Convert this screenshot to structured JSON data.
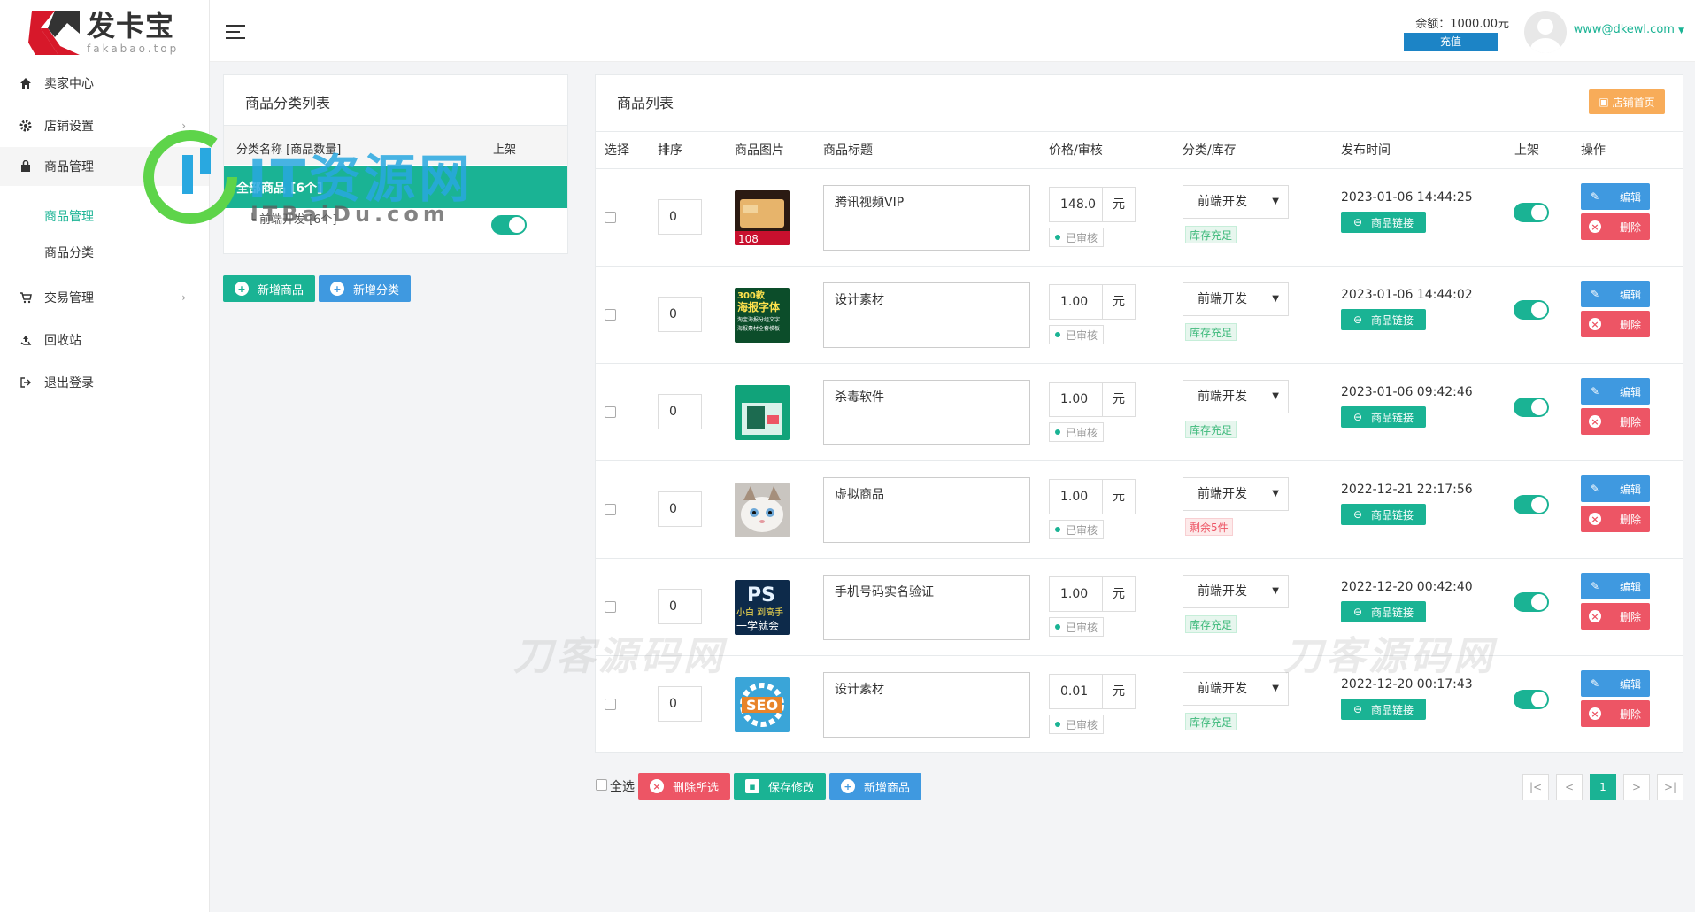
{
  "logo": {
    "title": "发卡宝",
    "subtitle": "fakabao.top"
  },
  "sidebar": {
    "items": [
      {
        "label": "卖家中心",
        "icon": "home-icon"
      },
      {
        "label": "店铺设置",
        "icon": "gear-icon"
      },
      {
        "label": "商品管理",
        "icon": "bag-icon"
      },
      {
        "label": "交易管理",
        "icon": "cart-icon"
      },
      {
        "label": "回收站",
        "icon": "recycle-icon"
      },
      {
        "label": "退出登录",
        "icon": "logout-icon"
      }
    ],
    "sub_items": [
      "商品管理",
      "商品分类"
    ]
  },
  "header": {
    "balance": "余额：1000.00元",
    "recharge": "充值",
    "email": "www@dkewl.com"
  },
  "category_panel": {
    "title": "商品分类列表",
    "col_name": "分类名称 [商品数量]",
    "col_online": "上架",
    "all_row": "全部商品 [6个]",
    "sub_row": "└ 前端开发 [6个]",
    "add_product": "新增商品",
    "add_category": "新增分类"
  },
  "product_panel": {
    "title": "商品列表",
    "shop_home": "店铺首页",
    "headers": [
      "选择",
      "排序",
      "商品图片",
      "商品标题",
      "价格/审核",
      "分类/库存",
      "发布时间",
      "上架",
      "操作"
    ],
    "link_label": "商品链接",
    "edit_label": "编辑",
    "delete_label": "删除",
    "audit_label": "已审核",
    "unit": "元",
    "rows": [
      {
        "sort": "0",
        "title": "腾讯视频VIP",
        "price": "148.0",
        "category": "前端开发",
        "stock": "库存充足",
        "stock_ok": true,
        "date": "2023-01-06 14:44:25",
        "img": "vip"
      },
      {
        "sort": "0",
        "title": "设计素材",
        "price": "1.00",
        "category": "前端开发",
        "stock": "库存充足",
        "stock_ok": true,
        "date": "2023-01-06 14:44:02",
        "img": "font"
      },
      {
        "sort": "0",
        "title": "杀毒软件",
        "price": "1.00",
        "category": "前端开发",
        "stock": "库存充足",
        "stock_ok": true,
        "date": "2023-01-06 09:42:46",
        "img": "av"
      },
      {
        "sort": "0",
        "title": "虚拟商品",
        "price": "1.00",
        "category": "前端开发",
        "stock": "剩余5件",
        "stock_ok": false,
        "date": "2022-12-21 22:17:56",
        "img": "cat"
      },
      {
        "sort": "0",
        "title": "手机号码实名验证",
        "price": "1.00",
        "category": "前端开发",
        "stock": "库存充足",
        "stock_ok": true,
        "date": "2022-12-20 00:42:40",
        "img": "ps"
      },
      {
        "sort": "0",
        "title": "设计素材",
        "price": "0.01",
        "category": "前端开发",
        "stock": "库存充足",
        "stock_ok": true,
        "date": "2022-12-20 00:17:43",
        "img": "seo"
      }
    ],
    "thumb_texts": {
      "font": [
        "300款",
        "海报字体",
        "淘宝海报分组文字",
        "海报素材全套模板"
      ],
      "ps": [
        "PS",
        "小白 到高手",
        "一学就会"
      ],
      "seo": "SEO",
      "vip_price": "108"
    }
  },
  "footer": {
    "select_all": "全选",
    "delete_selected": "删除所选",
    "save_changes": "保存修改",
    "add_product": "新增商品",
    "pagination": [
      "|<",
      "<",
      "1",
      ">",
      ">|"
    ]
  },
  "watermarks": {
    "top": "ITBaiDu.com",
    "brand": "IT资源网",
    "bottom": "刀客源码网"
  },
  "colors": {
    "primary": "#1ab394",
    "blue": "#3f99e0",
    "red": "#ed5565",
    "orange": "#f8ac59"
  }
}
